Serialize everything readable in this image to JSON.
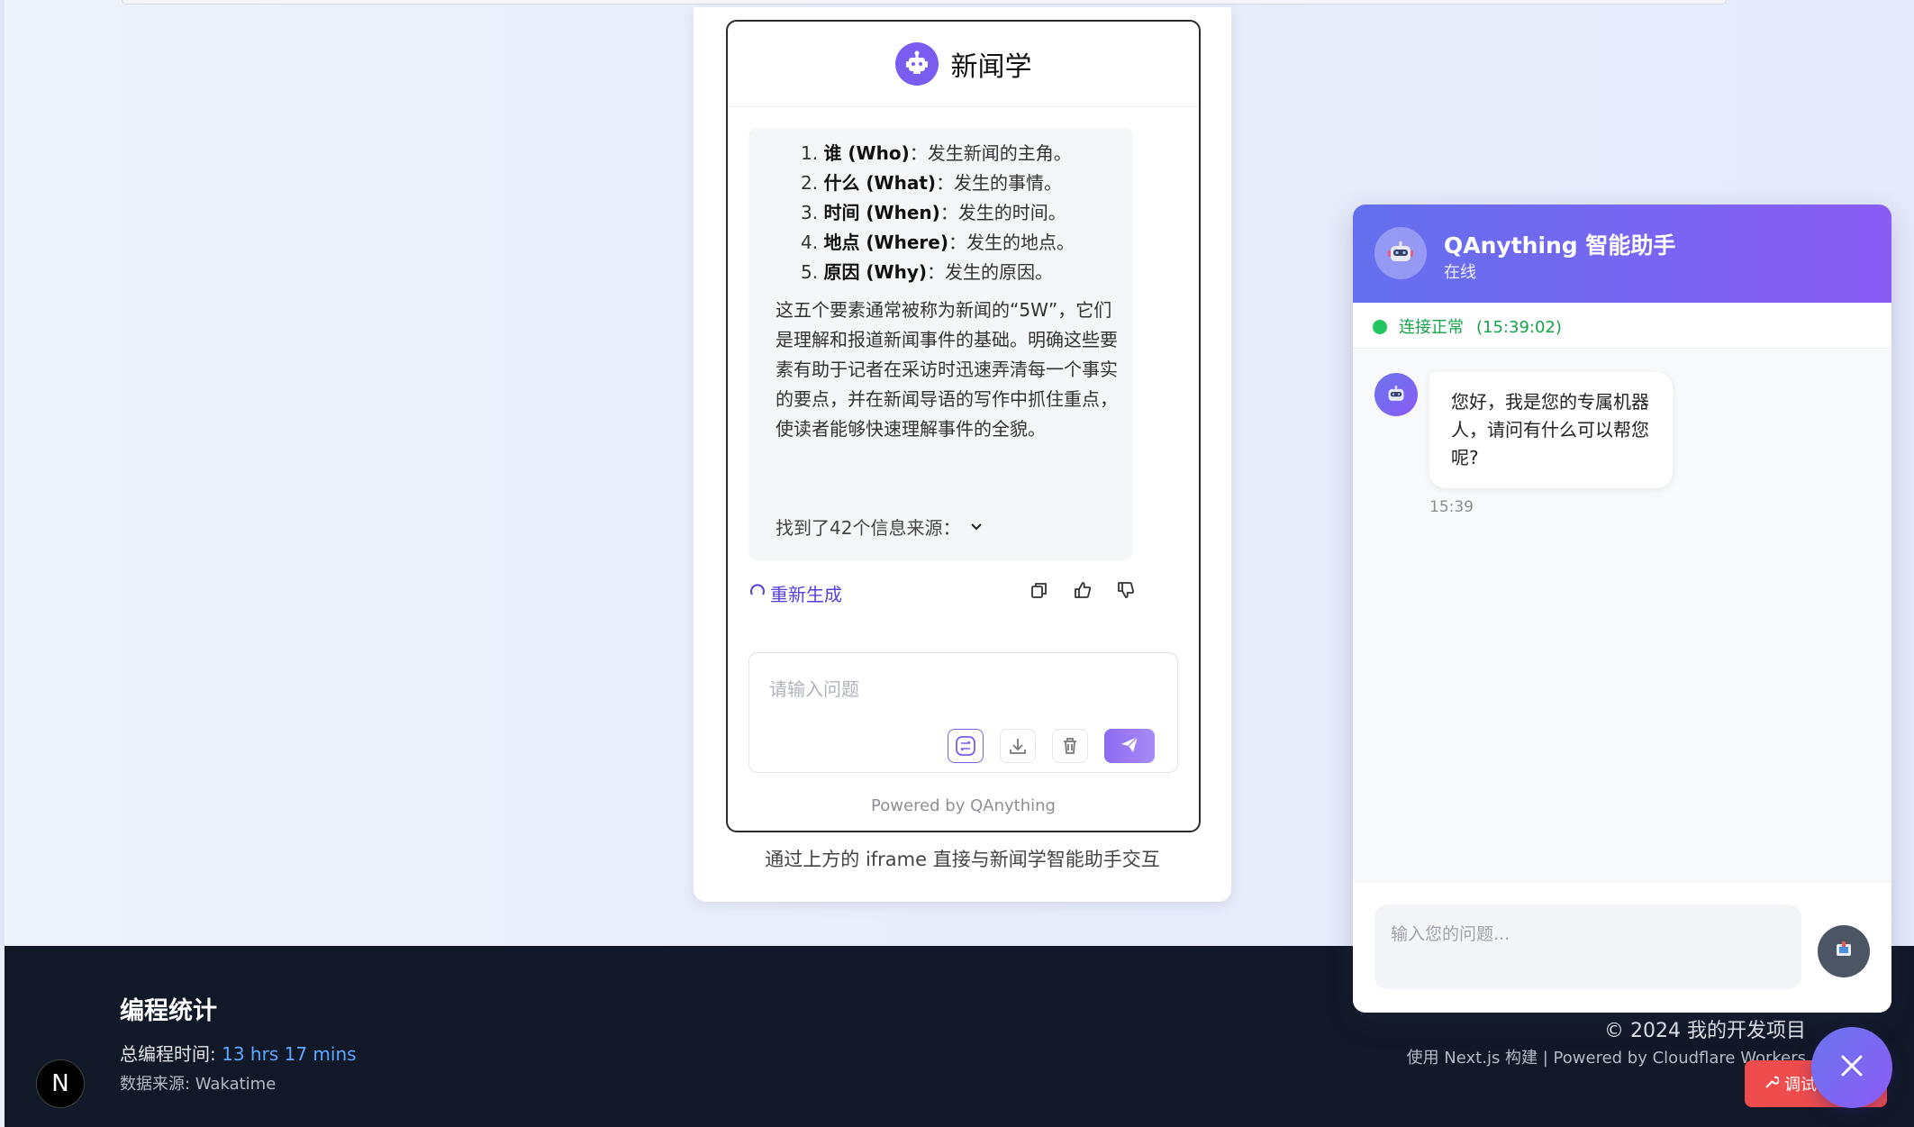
{
  "center": {
    "title": "新闻学",
    "list": [
      {
        "num": "1.",
        "bold": "谁 (Who)",
        "rest": "：发生新闻的主角。"
      },
      {
        "num": "2.",
        "bold": "什么 (What)",
        "rest": "：发生的事情。"
      },
      {
        "num": "3.",
        "bold": "时间 (When)",
        "rest": "：发生的时间。"
      },
      {
        "num": "4.",
        "bold": "地点 (Where)",
        "rest": "：发生的地点。"
      },
      {
        "num": "5.",
        "bold": "原因 (Why)",
        "rest": "：发生的原因。"
      }
    ],
    "paragraph": "这五个要素通常被称为新闻的“5W”，它们是理解和报道新闻事件的基础。明确这些要素有助于记者在采访时迅速弄清每一个事实的要点，并在新闻导语的写作中抓住重点，使读者能够快速理解事件的全貌。",
    "sources_label": "找到了42个信息来源：",
    "regenerate_label": "重新生成",
    "input_placeholder": "请输入问题",
    "powered_by": "Powered by QAnything",
    "caption": "通过上方的 iframe 直接与新闻学智能助手交互"
  },
  "chat": {
    "title": "QAnything 智能助手",
    "status": "在线",
    "connection_label": "连接正常",
    "connection_time": "(15:39:02)",
    "message": "您好，我是您的专属机器人，请问有什么可以帮您呢?",
    "message_time": "15:39",
    "input_placeholder": "输入您的问题..."
  },
  "footer": {
    "stats_title": "编程统计",
    "total_label": "总编程时间: ",
    "total_value": "13 hrs 17 mins",
    "source_label": "数据来源: Wakatime",
    "copyright": "© 2024 我的开发项目",
    "built_with": "使用 Next.js 构建 | Powered by Cloudflare Workers",
    "debug_label": "调试",
    "logo_letter": "N"
  },
  "colors": {
    "accent": "#7a5cf0",
    "chat_header_start": "#6470ee",
    "chat_header_end": "#8a5cf5",
    "footer_bg": "#111827",
    "online_green": "#22c55e",
    "debug_red": "#ef4d4d"
  },
  "icons": [
    "robot-icon",
    "chevron-down-icon",
    "refresh-icon",
    "copy-icon",
    "thumbs-up-icon",
    "thumbs-down-icon",
    "switch-icon",
    "download-icon",
    "trash-icon",
    "send-icon",
    "close-icon",
    "wrench-icon"
  ]
}
